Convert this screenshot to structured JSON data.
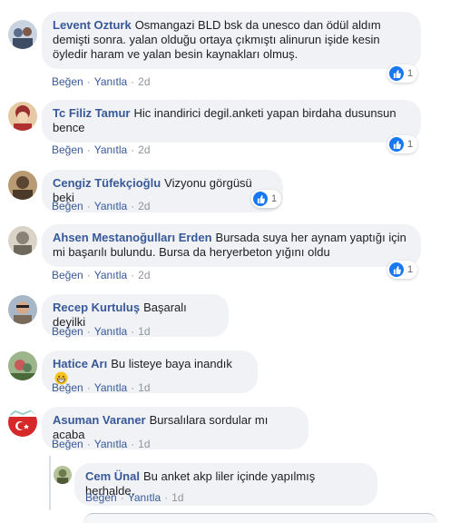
{
  "action_labels": {
    "like": "Beğen",
    "reply": "Yanıtla",
    "separator": "·"
  },
  "comments": [
    {
      "author": "Levent Ozturk",
      "text": "Osmangazi BLD bsk da unesco dan ödül aldım demişti sonra. yalan olduğu ortaya çıkmıştı alinurun işide kesin öyledir haram ve yalan besin kaynakları olmuş.",
      "time": "2d",
      "reactions": "1",
      "avatar_color": "#5a6e8c"
    },
    {
      "author": "Tc Filiz Tamur",
      "text": "Hic inandirici degil.anketi yapan birdaha dusunsun bence",
      "time": "2d",
      "reactions": "1",
      "avatar_color": "#a33a3a"
    },
    {
      "author": "Cengiz Tüfekçioğlu",
      "text": "Vizyonu görgüsü beki",
      "time": "2d",
      "reactions": "1",
      "avatar_color": "#6d5b44"
    },
    {
      "author": "Ahsen Mestanoğulları Erden",
      "text": "Bursada suya her aynam yaptığı için mi başarılı bulundu. Bursa da heryerbeton yığını oldu",
      "time": "2d",
      "reactions": "1",
      "avatar_color": "#8a8275"
    },
    {
      "author": "Recep Kurtuluş",
      "text": "Başaralı deyilki",
      "time": "1d",
      "reactions": "",
      "avatar_color": "#7a6a5a"
    },
    {
      "author": "Hatice Arı",
      "text": "Bu listeye baya inandık",
      "time": "1d",
      "reactions": "",
      "avatar_color": "#5b7f5b",
      "emoji": "grinning-face"
    },
    {
      "author": "Asuman Varaner",
      "text": "Bursalılara sordular mı acaba",
      "time": "1d",
      "reactions": "",
      "avatar_color": "#d62828"
    }
  ],
  "reply": {
    "author": "Cem Ünal",
    "text": "Bu anket akp liler içinde yapılmış herhalde.",
    "time": "1d",
    "avatar_color": "#6c7a4e"
  },
  "colors": {
    "author": "#385898",
    "bubble": "#f0f2f5",
    "like_blue": "#1877f2",
    "meta": "#90949c"
  }
}
